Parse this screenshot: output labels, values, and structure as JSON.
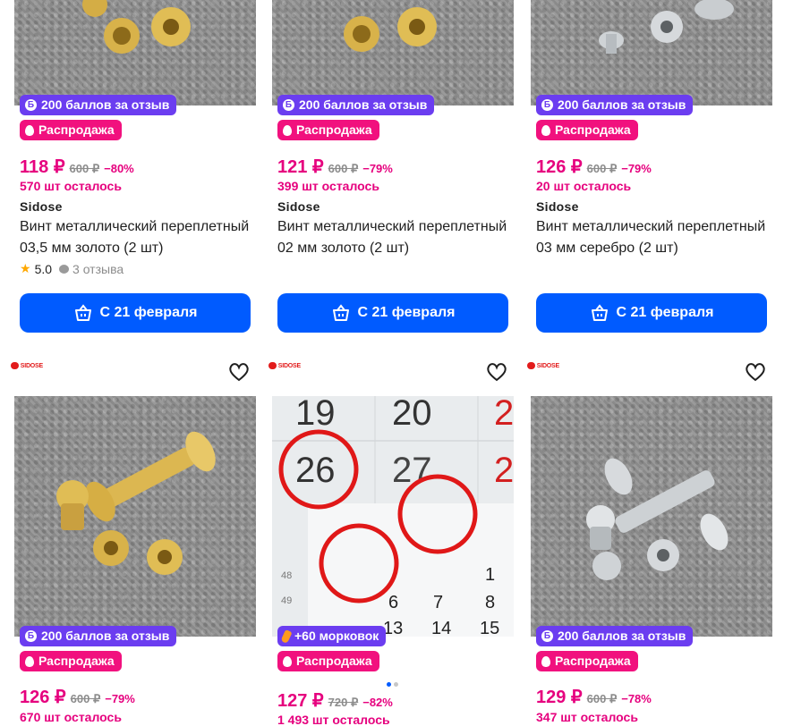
{
  "cards": [
    {
      "points_badge": "200 баллов за отзыв",
      "sale_badge": "Распродажа",
      "price": "118 ₽",
      "old_price": "600 ₽",
      "discount": "−80%",
      "stock": "570 шт осталось",
      "brand": "Sidose",
      "title": "Винт металлический переплетный 03,5 мм золото (2 шт)",
      "rating": "5.0",
      "reviews": "3 отзыва",
      "cart_label": "С 21 февраля"
    },
    {
      "points_badge": "200 баллов за отзыв",
      "sale_badge": "Распродажа",
      "price": "121 ₽",
      "old_price": "600 ₽",
      "discount": "−79%",
      "stock": "399 шт осталось",
      "brand": "Sidose",
      "title": "Винт металлический переплетный 02 мм золото (2 шт)",
      "cart_label": "С 21 февраля"
    },
    {
      "points_badge": "200 баллов за отзыв",
      "sale_badge": "Распродажа",
      "price": "126 ₽",
      "old_price": "600 ₽",
      "discount": "−79%",
      "stock": "20 шт осталось",
      "brand": "Sidose",
      "title": "Винт металлический переплетный 03 мм серебро (2 шт)",
      "cart_label": "С 21 февраля"
    },
    {
      "logo": "SIDOSE",
      "points_badge": "200 баллов за отзыв",
      "sale_badge": "Распродажа",
      "price": "126 ₽",
      "old_price": "600 ₽",
      "discount": "−79%",
      "stock": "670 шт осталось"
    },
    {
      "logo": "SIDOSE",
      "carrot_badge": "+60 морковок",
      "sale_badge": "Распродажа",
      "price": "127 ₽",
      "old_price": "720 ₽",
      "discount": "−82%",
      "stock": "1 493 шт осталось",
      "calendar": {
        "row1": [
          "19",
          "20",
          "2"
        ],
        "row2": [
          "26",
          "27",
          "2"
        ],
        "small_left": [
          "48",
          "49"
        ],
        "grid_row1": [
          "1"
        ],
        "grid_row2": [
          "6",
          "7",
          "8"
        ],
        "grid_row3": [
          "13",
          "14",
          "15"
        ]
      }
    },
    {
      "logo": "SIDOSE",
      "points_badge": "200 баллов за отзыв",
      "sale_badge": "Распродажа",
      "price": "129 ₽",
      "old_price": "600 ₽",
      "discount": "−78%",
      "stock": "347 шт осталось"
    }
  ],
  "icons": {
    "cart": "basket-icon",
    "favorite": "heart-icon",
    "sale": "flame-icon",
    "points": "b-coin-icon"
  },
  "colors": {
    "price": "#e6007e",
    "button": "#005bff",
    "points_badge": "#6b3df0",
    "sale_badge": "#f1117e"
  }
}
